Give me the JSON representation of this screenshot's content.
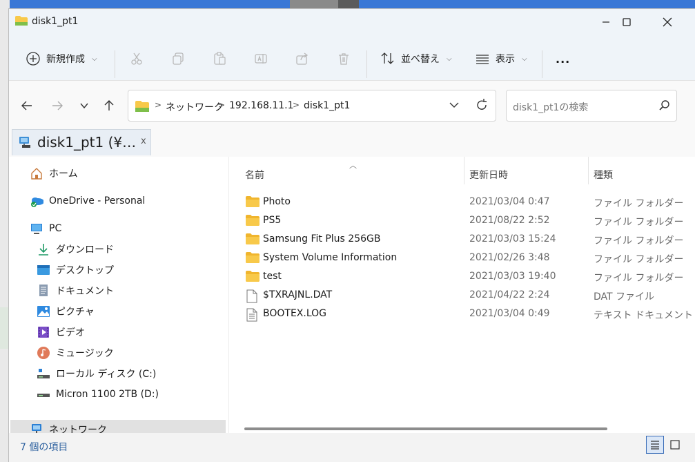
{
  "window": {
    "title": "disk1_pt1"
  },
  "toolbar": {
    "new_label": "新規作成",
    "sort_label": "並べ替え",
    "view_label": "表示",
    "more_label": "..."
  },
  "address": {
    "crumbs": [
      "ネットワーク",
      "192.168.11.1",
      "disk1_pt1"
    ]
  },
  "search": {
    "placeholder": "disk1_pt1の検索"
  },
  "tab": {
    "label": "disk1_pt1 (¥…",
    "close": "x"
  },
  "sidebar": {
    "items": [
      {
        "label": "ホーム",
        "icon": "home-icon"
      },
      {
        "label": "OneDrive - Personal",
        "icon": "onedrive-icon"
      },
      {
        "label": "PC",
        "icon": "pc-icon"
      },
      {
        "label": "ダウンロード",
        "icon": "download-icon"
      },
      {
        "label": "デスクトップ",
        "icon": "desktop-icon"
      },
      {
        "label": "ドキュメント",
        "icon": "document-icon"
      },
      {
        "label": "ピクチャ",
        "icon": "picture-icon"
      },
      {
        "label": "ビデオ",
        "icon": "video-icon"
      },
      {
        "label": "ミュージック",
        "icon": "music-icon"
      },
      {
        "label": "ローカル ディスク (C:)",
        "icon": "drive-icon"
      },
      {
        "label": "Micron 1100 2TB (D:)",
        "icon": "drive-icon"
      },
      {
        "label": "ネットワーク",
        "icon": "network-icon"
      }
    ]
  },
  "columns": {
    "name": "名前",
    "date": "更新日時",
    "type": "種類"
  },
  "files": [
    {
      "name": "Photo",
      "date": "2021/03/04 0:47",
      "type": "ファイル フォルダー",
      "kind": "folder"
    },
    {
      "name": "PS5",
      "date": "2021/08/22 2:52",
      "type": "ファイル フォルダー",
      "kind": "folder"
    },
    {
      "name": "Samsung Fit Plus 256GB",
      "date": "2021/03/03 15:24",
      "type": "ファイル フォルダー",
      "kind": "folder"
    },
    {
      "name": "System Volume Information",
      "date": "2021/02/26 3:48",
      "type": "ファイル フォルダー",
      "kind": "folder"
    },
    {
      "name": "test",
      "date": "2021/03/03 19:40",
      "type": "ファイル フォルダー",
      "kind": "folder"
    },
    {
      "name": "$TXRAJNL.DAT",
      "date": "2021/04/22 2:24",
      "type": "DAT ファイル",
      "kind": "file"
    },
    {
      "name": "BOOTEX.LOG",
      "date": "2021/03/04 0:49",
      "type": "テキスト ドキュメント",
      "kind": "text"
    }
  ],
  "status": {
    "count": "7 個の項目"
  },
  "colors": {
    "accent": "#3a6db8",
    "folder": "#f8c94a"
  }
}
